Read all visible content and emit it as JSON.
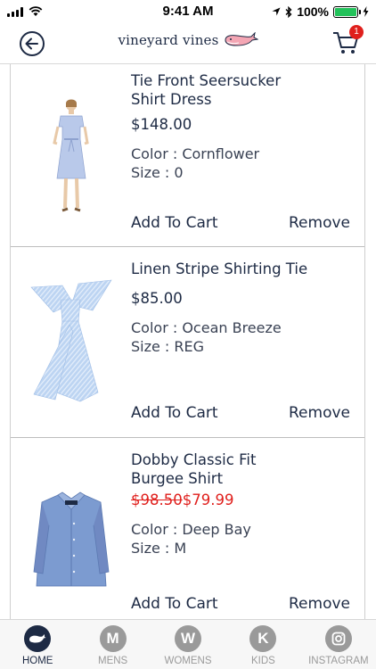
{
  "status_bar": {
    "time": "9:41 AM",
    "battery": "100%",
    "battery_level": 1.0
  },
  "header": {
    "brand": "vineyard vines",
    "cart_count": "1"
  },
  "products": [
    {
      "name_line1": "Tie Front Seersucker",
      "name_line2": "Shirt Dress",
      "price": "$148.00",
      "color": "Color : Cornflower",
      "size": "Size : 0",
      "add_to_cart": "Add To Cart",
      "remove": "Remove"
    },
    {
      "name_line1": "Linen Stripe Shirting Tie",
      "name_line2": "",
      "price": "$85.00",
      "color": "Color : Ocean Breeze",
      "size": "Size : REG",
      "add_to_cart": "Add To Cart",
      "remove": "Remove"
    },
    {
      "name_line1": "Dobby Classic Fit",
      "name_line2": "Burgee Shirt",
      "price_original": "$98.50",
      "price_sale": "$79.99",
      "color": "Color : Deep Bay",
      "size": "Size : M",
      "add_to_cart": "Add To Cart",
      "remove": "Remove"
    }
  ],
  "tabs": [
    {
      "label": "HOME",
      "icon": "whale-icon",
      "active": true
    },
    {
      "label": "MENS",
      "letter": "M"
    },
    {
      "label": "WOMENS",
      "letter": "W"
    },
    {
      "label": "KIDS",
      "letter": "K"
    },
    {
      "label": "INSTAGRAM",
      "icon": "instagram-icon"
    }
  ],
  "colors": {
    "navy": "#1d2a44",
    "sale_red": "#e0201d",
    "badge_red": "#e0201d",
    "tab_gray": "#9a9a9a"
  }
}
